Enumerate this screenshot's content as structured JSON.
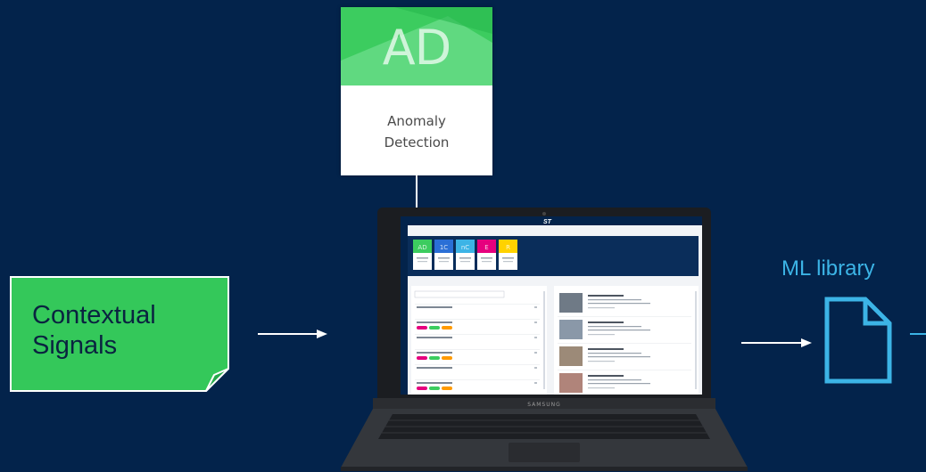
{
  "ad_card": {
    "abbreviation": "AD",
    "title_line1": "Anomaly",
    "title_line2": "Detection",
    "header_color": "#3ccc5f"
  },
  "contextual_signals": {
    "line1": "Contextual",
    "line2": "Signals",
    "color": "#34c85a"
  },
  "ml_library": {
    "label": "ML library",
    "color": "#3cb4e6"
  },
  "laptop": {
    "brand": "SAMSUNG",
    "screen": {
      "app_tiles": [
        {
          "abbr": "AD",
          "color": "#3ccc5f"
        },
        {
          "abbr": "1C",
          "color": "#2a6fd6"
        },
        {
          "abbr": "nC",
          "color": "#3cb4e6"
        },
        {
          "abbr": "E",
          "color": "#e6007e"
        },
        {
          "abbr": "R",
          "color": "#ffd200"
        }
      ],
      "tag_colors": [
        "#e6007e",
        "#3ccc5f",
        "#ff9a00",
        "#3cb4e6"
      ]
    }
  },
  "colors": {
    "background": "#03234b",
    "arrow": "#ffffff"
  }
}
